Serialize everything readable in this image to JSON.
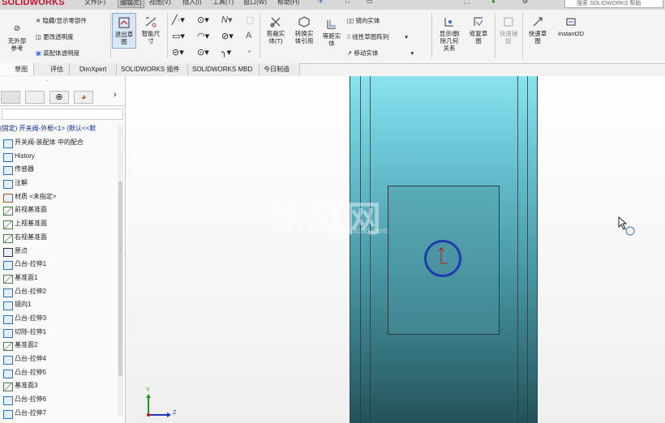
{
  "app": {
    "logo": "SOLIDWORKS",
    "search_placeholder": "搜索 SOLIDWORKS 帮助"
  },
  "menus": [
    "文件(F)",
    "编辑(E)",
    "视图(V)",
    "插入(I)",
    "工具(T)",
    "窗口(W)",
    "帮助(H)"
  ],
  "ribbon": {
    "left_items": [
      {
        "label": "无外部\n参考",
        "enabled": true
      }
    ],
    "vis_items": [
      "隐藏/显示零部件",
      "更改透明度",
      "装配体透明度"
    ],
    "exit_sketch": "退出草\n图",
    "smart_dim": "智能尺\n寸",
    "trim": "剪裁实\n体(T)",
    "convert": "转换实\n体引用",
    "offset": "等距实\n体",
    "mirror": "镜向实体",
    "linear_pattern": "线性草图阵列",
    "move": "移动实体",
    "show_delete": "显示/删\n除几何\n关系",
    "repair": "修复草\n图",
    "quick_snap_grey": "快速捕\n捉",
    "quick_sketch": "快速草\n图",
    "instant2d": "Instant2D"
  },
  "tabs": [
    "草图",
    "评估",
    "DimXpert",
    "SOLIDWORKS 插件",
    "SOLIDWORKS MBD",
    "今日制造"
  ],
  "tree": {
    "header": "(固定) 开关阀-外框<1> (默认<<默",
    "items": [
      {
        "icon": "mates-icon",
        "label": "开关阀-装配体 中的配合"
      },
      {
        "icon": "history-icon",
        "label": "History"
      },
      {
        "icon": "sensor-icon",
        "label": "传感器"
      },
      {
        "icon": "annotation-icon",
        "label": "注解"
      },
      {
        "icon": "material-icon",
        "label": "材质 <未指定>"
      },
      {
        "icon": "plane-icon",
        "label": "前视基准面"
      },
      {
        "icon": "plane-icon",
        "label": "上视基准面"
      },
      {
        "icon": "plane-icon",
        "label": "右视基准面"
      },
      {
        "icon": "origin-icon",
        "label": "原点"
      },
      {
        "icon": "extrude-icon",
        "label": "凸台-拉伸1"
      },
      {
        "icon": "plane-icon",
        "label": "基准面1"
      },
      {
        "icon": "extrude-icon",
        "label": "凸台-拉伸2"
      },
      {
        "icon": "mirror-icon",
        "label": "镜向1"
      },
      {
        "icon": "extrude-icon",
        "label": "凸台-拉伸3"
      },
      {
        "icon": "cut-icon",
        "label": "切除-拉伸1"
      },
      {
        "icon": "plane-icon",
        "label": "基准面2"
      },
      {
        "icon": "extrude-icon",
        "label": "凸台-拉伸4"
      },
      {
        "icon": "extrude-icon",
        "label": "凸台-拉伸5"
      },
      {
        "icon": "plane-icon",
        "label": "基准面3"
      },
      {
        "icon": "extrude-icon",
        "label": "凸台-拉伸6"
      },
      {
        "icon": "extrude-icon",
        "label": "凸台-拉伸7"
      }
    ]
  },
  "viewport": {
    "watermark": "沐风网",
    "watermark_url": "www.mfcad.com",
    "axis_y": "Y",
    "axis_z": "Z"
  },
  "colors": {
    "part_top": "#8ee8f2",
    "part_bottom": "#234e55",
    "hole_ring": "#1e3db0",
    "logo_red": "#c8102e"
  }
}
